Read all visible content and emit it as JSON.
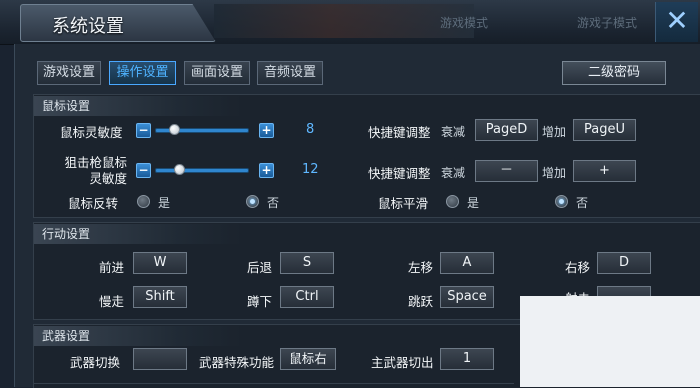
{
  "title": "系统设置",
  "faint_tabs": [
    "游戏模式",
    "游戏子模式"
  ],
  "close_glyph": "✕",
  "tabs": [
    "游戏设置",
    "操作设置",
    "画面设置",
    "音频设置"
  ],
  "active_tab": 1,
  "password_button": "二级密码",
  "mouse": {
    "header": "鼠标设置",
    "sensitivity": {
      "label": "鼠标灵敏度",
      "value": "8",
      "level": 0.17
    },
    "sniper": {
      "label_line1": "狙击枪鼠标",
      "label_line2": "灵敏度",
      "value": "12",
      "level": 0.23
    },
    "shortcut1": {
      "label": "快捷键调整",
      "decrease_label": "衰减",
      "decrease_key": "PageD",
      "increase_label": "增加",
      "increase_key": "PageU"
    },
    "shortcut2": {
      "label": "快捷键调整",
      "decrease_label": "衰减",
      "decrease_key": "－",
      "increase_label": "增加",
      "increase_key": "+"
    },
    "invert": {
      "label": "鼠标反转",
      "yes": "是",
      "no": "否",
      "selected": "否"
    },
    "smooth": {
      "label": "鼠标平滑",
      "yes": "是",
      "no": "否",
      "selected": "否"
    },
    "minus": "−",
    "plus": "+"
  },
  "movement": {
    "header": "行动设置",
    "forward": {
      "label": "前进",
      "key": "W"
    },
    "back": {
      "label": "后退",
      "key": "S"
    },
    "left": {
      "label": "左移",
      "key": "A"
    },
    "right": {
      "label": "右移",
      "key": "D"
    },
    "walk": {
      "label": "慢走",
      "key": "Shift"
    },
    "crouch": {
      "label": "蹲下",
      "key": "Ctrl"
    },
    "jump": {
      "label": "跳跃",
      "key": "Space"
    },
    "fire": {
      "label": "射击",
      "key": ""
    }
  },
  "weapon": {
    "header": "武器设置",
    "switch": {
      "label": "武器切换",
      "key": ""
    },
    "special": {
      "label": "武器特殊功能",
      "key": "鼠标右"
    },
    "primary": {
      "label": "主武器切出",
      "key": "1"
    }
  }
}
